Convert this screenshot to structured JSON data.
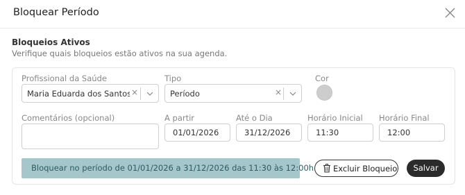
{
  "dialog": {
    "title": "Bloquear Período"
  },
  "section": {
    "title": "Bloqueios Ativos",
    "subtitle": "Verifique quais bloqueios estão ativos na sua agenda."
  },
  "form": {
    "profissional_label": "Profissional da Saúde",
    "profissional_value": "Maria Eduarda dos Santos ...",
    "tipo_label": "Tipo",
    "tipo_value": "Período",
    "cor_label": "Cor",
    "cor_value": "#cdcdcd",
    "comentarios_label": "Comentários (opcional)",
    "comentarios_value": "",
    "apartir_label": "A partir",
    "apartir_value": "01/01/2026",
    "ateodia_label": "Até o Dia",
    "ateodia_value": "31/12/2026",
    "horario_inicial_label": "Horário Inicial",
    "horario_inicial_value": "11:30",
    "horario_final_label": "Horário Final",
    "horario_final_value": "12:00"
  },
  "summary": "Bloquear no período de 01/01/2026 a 31/12/2026 das 11:30 às 12:00h.",
  "actions": {
    "delete_label": "Excluir Bloqueio",
    "save_label": "Salvar"
  },
  "colors": {
    "info_bg": "#a5c6cb",
    "save_bg": "#2b2b2b"
  }
}
